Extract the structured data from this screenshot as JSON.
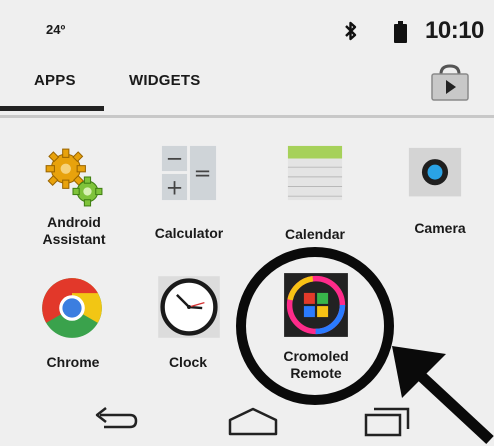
{
  "status_bar": {
    "temperature": "24º",
    "time": "10:10"
  },
  "tabs": [
    {
      "label": "APPS",
      "selected": true
    },
    {
      "label": "WIDGETS",
      "selected": false
    }
  ],
  "apps": [
    {
      "label": "Android Assistant",
      "icon": "gears-icon"
    },
    {
      "label": "Calculator",
      "icon": "calculator-icon"
    },
    {
      "label": "Calendar",
      "icon": "calendar-icon"
    },
    {
      "label": "Camera",
      "icon": "camera-icon"
    },
    {
      "label": "Chrome",
      "icon": "chrome-icon"
    },
    {
      "label": "Clock",
      "icon": "clock-icon"
    },
    {
      "label": "Cromoled Remote",
      "icon": "cromoled-icon"
    }
  ],
  "nav_bar": {
    "buttons": [
      "back",
      "home",
      "recent-apps"
    ]
  },
  "colors": {
    "background": "#efefef",
    "calendar_green": "#a6d15a",
    "camera_blue": "#2aa3e6"
  }
}
